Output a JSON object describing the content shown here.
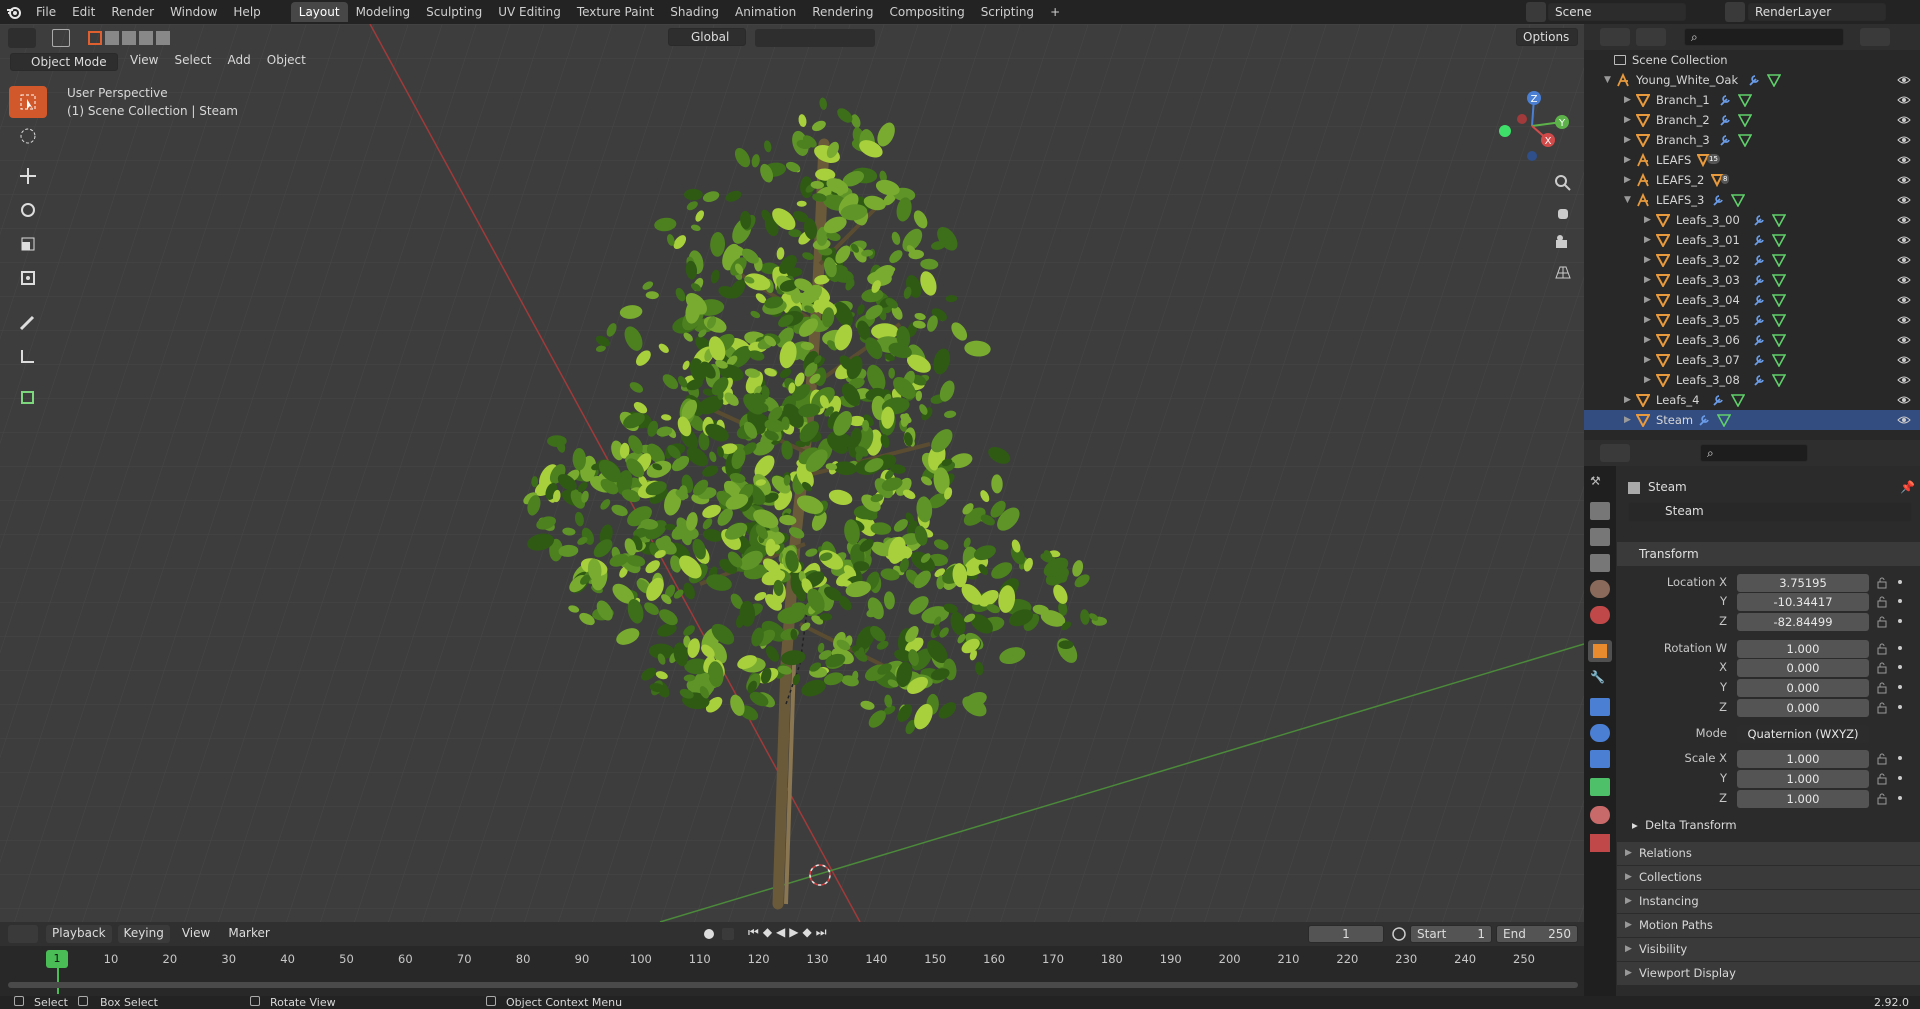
{
  "menus": [
    "File",
    "Edit",
    "Render",
    "Window",
    "Help"
  ],
  "workspaces": [
    {
      "label": "Layout",
      "active": true
    },
    {
      "label": "Modeling"
    },
    {
      "label": "Sculpting"
    },
    {
      "label": "UV Editing"
    },
    {
      "label": "Texture Paint"
    },
    {
      "label": "Shading"
    },
    {
      "label": "Animation"
    },
    {
      "label": "Rendering"
    },
    {
      "label": "Compositing"
    },
    {
      "label": "Scripting"
    }
  ],
  "add_tab": "+",
  "scene_name": "Scene",
  "render_layer": "RenderLayer",
  "viewport_header": {
    "mode": "Object Mode",
    "menus": [
      "View",
      "Select",
      "Add",
      "Object"
    ],
    "orientation": "Global",
    "options": "Options"
  },
  "viewport_info": {
    "perspective": "User Perspective",
    "collection": "(1) Scene Collection | Steam"
  },
  "gizmo": {
    "z": "Z",
    "y": "Y",
    "x": "X"
  },
  "outliner": {
    "root": "Scene Collection",
    "rows": [
      {
        "label": "Young_White_Oak",
        "indent": 1,
        "type": "empty",
        "expanded": true
      },
      {
        "label": "Branch_1",
        "indent": 2,
        "type": "mesh"
      },
      {
        "label": "Branch_2",
        "indent": 2,
        "type": "mesh"
      },
      {
        "label": "Branch_3",
        "indent": 2,
        "type": "mesh"
      },
      {
        "label": "LEAFS",
        "indent": 2,
        "type": "empty",
        "badge": "15"
      },
      {
        "label": "LEAFS_2",
        "indent": 2,
        "type": "empty",
        "badge": "8"
      },
      {
        "label": "LEAFS_3",
        "indent": 2,
        "type": "empty",
        "expanded": true
      },
      {
        "label": "Leafs_3_00",
        "indent": 3,
        "type": "mesh"
      },
      {
        "label": "Leafs_3_01",
        "indent": 3,
        "type": "mesh"
      },
      {
        "label": "Leafs_3_02",
        "indent": 3,
        "type": "mesh"
      },
      {
        "label": "Leafs_3_03",
        "indent": 3,
        "type": "mesh"
      },
      {
        "label": "Leafs_3_04",
        "indent": 3,
        "type": "mesh"
      },
      {
        "label": "Leafs_3_05",
        "indent": 3,
        "type": "mesh"
      },
      {
        "label": "Leafs_3_06",
        "indent": 3,
        "type": "mesh"
      },
      {
        "label": "Leafs_3_07",
        "indent": 3,
        "type": "mesh"
      },
      {
        "label": "Leafs_3_08",
        "indent": 3,
        "type": "mesh"
      },
      {
        "label": "Leafs_4",
        "indent": 2,
        "type": "mesh"
      },
      {
        "label": "Steam",
        "indent": 2,
        "type": "mesh",
        "selected": true
      }
    ]
  },
  "properties": {
    "object_name": "Steam",
    "datablock": "Steam",
    "transform_title": "Transform",
    "location_label": "Location X",
    "loc_x": "3.75195",
    "loc_y": "-10.34417",
    "loc_z": "-82.84499",
    "rotation_label": "Rotation W",
    "rot_w": "1.000",
    "rot_x": "0.000",
    "rot_y": "0.000",
    "rot_z": "0.000",
    "mode_label": "Mode",
    "mode_value": "Quaternion (WXYZ)",
    "scale_label": "Scale X",
    "scale_x": "1.000",
    "scale_y": "1.000",
    "scale_z": "1.000",
    "y": "Y",
    "z": "Z",
    "x": "X",
    "delta": "Delta Transform",
    "sections": [
      "Relations",
      "Collections",
      "Instancing",
      "Motion Paths",
      "Visibility",
      "Viewport Display"
    ]
  },
  "timeline": {
    "menus": [
      "Playback",
      "Keying",
      "View",
      "Marker"
    ],
    "current_frame": "1",
    "start_label": "Start",
    "start": "1",
    "end_label": "End",
    "end": "250",
    "ticks": [
      "10",
      "20",
      "30",
      "40",
      "50",
      "60",
      "70",
      "80",
      "90",
      "100",
      "110",
      "120",
      "130",
      "140",
      "150",
      "160",
      "170",
      "180",
      "190",
      "200",
      "210",
      "220",
      "230",
      "240",
      "250"
    ],
    "frame_marker": "1"
  },
  "status": {
    "select": "Select",
    "box_select": "Box Select",
    "rotate": "Rotate View",
    "context": "Object Context Menu",
    "version": "2.92.0"
  }
}
